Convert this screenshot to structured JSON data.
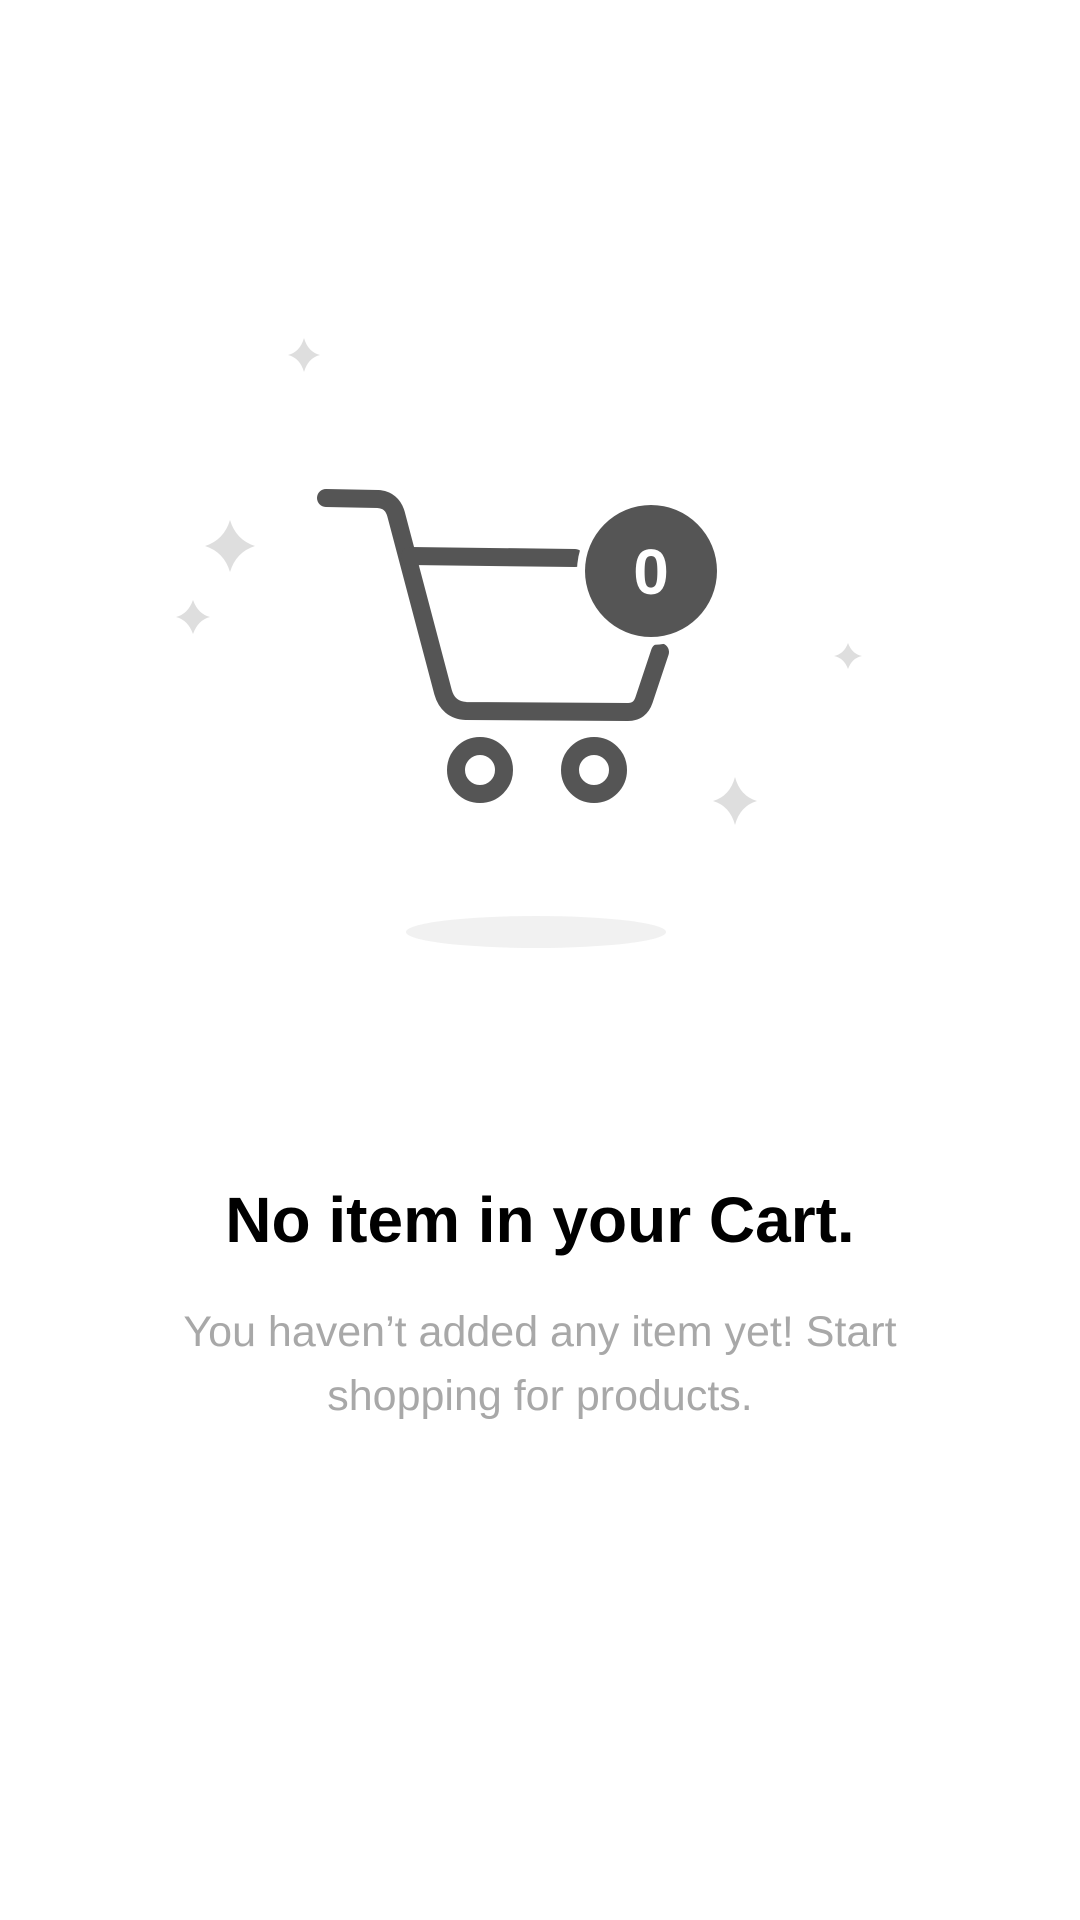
{
  "empty_state": {
    "cart_icon": "shopping-cart-icon",
    "sparkle_icon": "sparkle-icon",
    "badge_count": "0",
    "title": "No item in your Cart.",
    "message": "You haven’t added any item yet! Start shopping for products."
  },
  "colors": {
    "icon": "#555555",
    "sparkle": "#dedede",
    "shadow": "#f1f1f1",
    "title": "#000000",
    "message": "#a8a8a8",
    "background": "#ffffff"
  }
}
